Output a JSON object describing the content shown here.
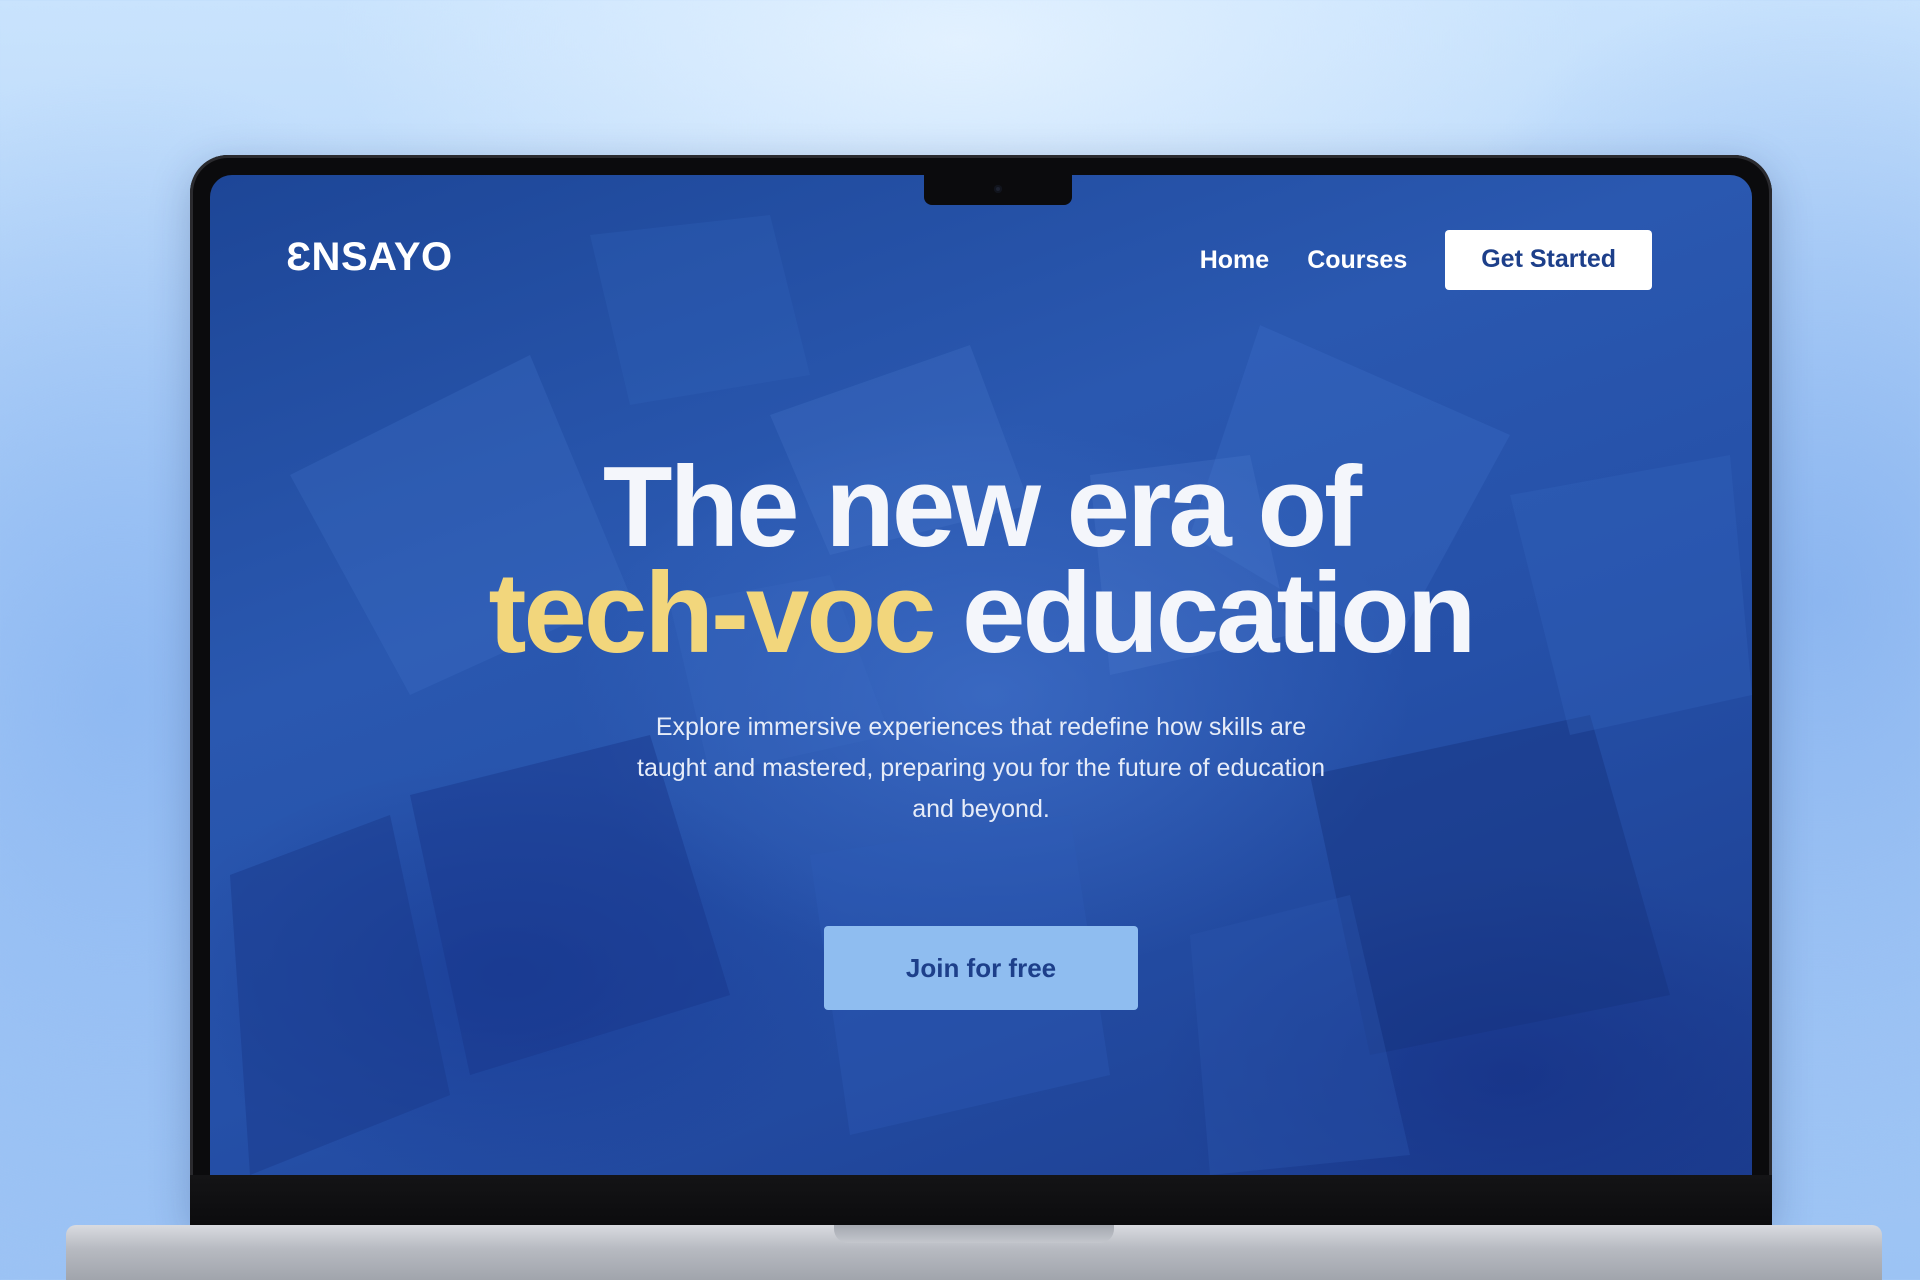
{
  "site": {
    "logo": "ƐNSAYO",
    "nav": {
      "home": "Home",
      "courses": "Courses",
      "get_started": "Get Started"
    }
  },
  "hero": {
    "title_line1": "The new era of",
    "title_accent": "tech-voc",
    "title_rest": "education",
    "subtitle": "Explore immersive experiences that redefine how skills are taught and mastered, preparing you for the future of education and beyond.",
    "cta": "Join for free"
  },
  "colors": {
    "accent_yellow": "#f2d67c",
    "screen_blue": "#2550a8",
    "button_light_blue": "#8fbdf0",
    "brand_dark_blue": "#1d3f8a"
  }
}
